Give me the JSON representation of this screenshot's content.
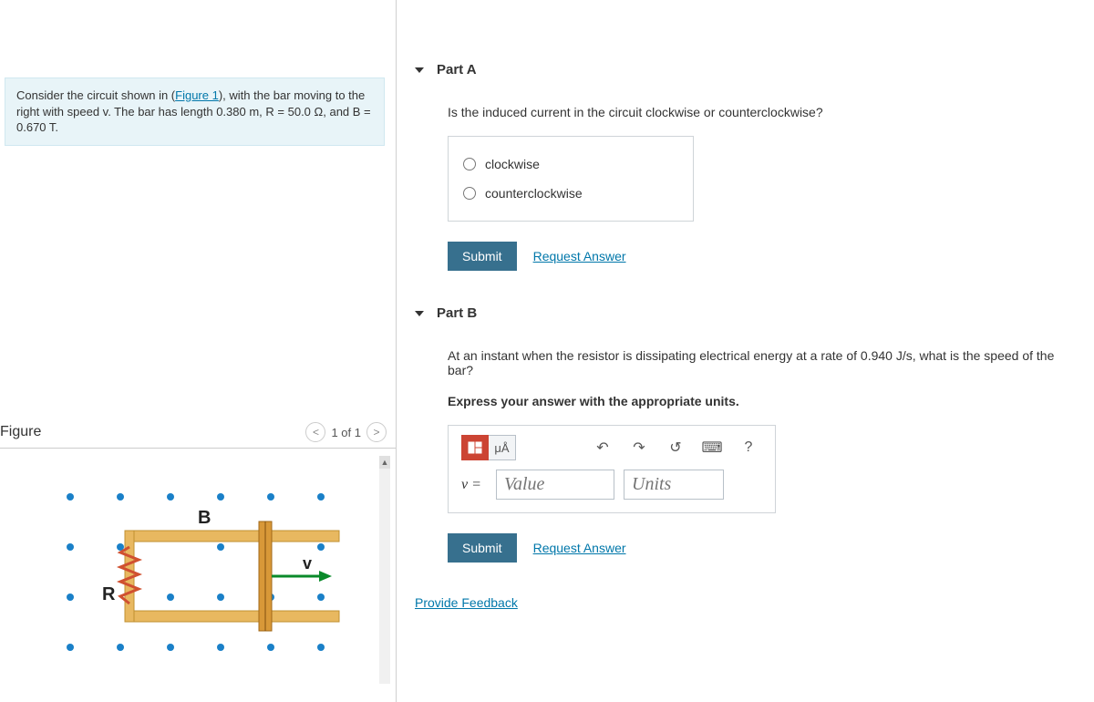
{
  "problem": {
    "text_pre": "Consider the circuit shown in (",
    "figure_link": "Figure 1",
    "text_post": "), with the bar moving to the right with speed v. The bar has length 0.380 m, R = 50.0 Ω, and B = 0.670 T."
  },
  "figure": {
    "title": "Figure",
    "pager": "1 of 1",
    "labels": {
      "B": "B",
      "R": "R",
      "v": "v"
    }
  },
  "partA": {
    "label": "Part A",
    "question": "Is the induced current in the circuit clockwise or counterclockwise?",
    "opt1": "clockwise",
    "opt2": "counterclockwise",
    "submit": "Submit",
    "request": "Request Answer"
  },
  "partB": {
    "label": "Part B",
    "question": "At an instant when the resistor is dissipating electrical energy at a rate of 0.940 J/s, what is the speed of the bar?",
    "instruct": "Express your answer with the appropriate units.",
    "toolbar": {
      "muA": "μÅ",
      "help": "?"
    },
    "var": "v =",
    "value_ph": "Value",
    "units_ph": "Units",
    "submit": "Submit",
    "request": "Request Answer"
  },
  "feedback": "Provide Feedback"
}
